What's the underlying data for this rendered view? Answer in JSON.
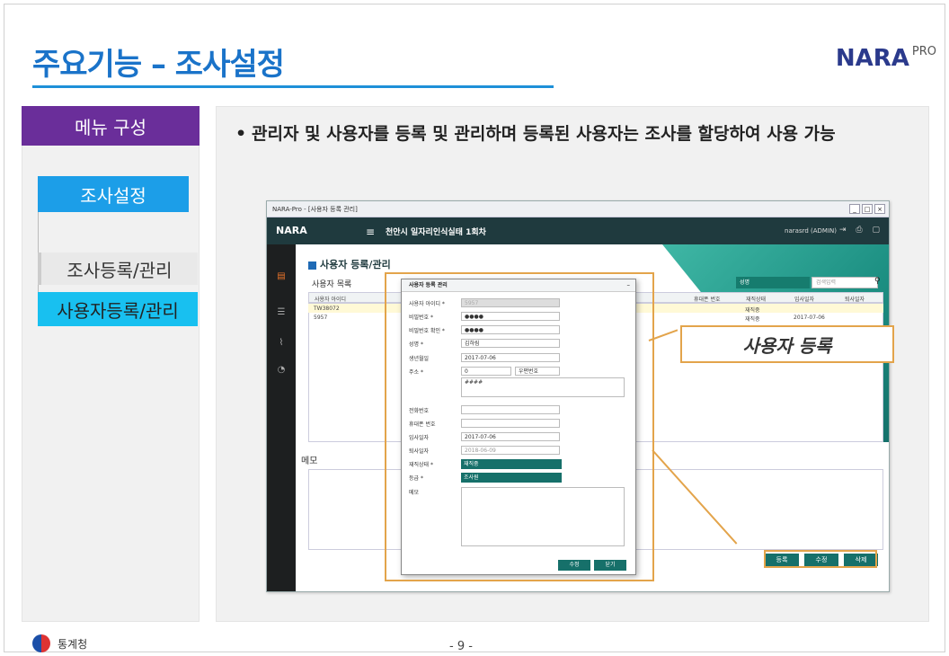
{
  "slide": {
    "title": "주요기능 – 조사설정",
    "logo_text": "NARA",
    "logo_suffix": "PRO",
    "page_number": "- 9 -",
    "footer_org": "통계청"
  },
  "menu": {
    "header": "메뉴 구성",
    "items": [
      {
        "label": "조사설정"
      },
      {
        "label": "조사등록/관리"
      },
      {
        "label": "사용자등록/관리"
      }
    ]
  },
  "description": {
    "bullet": "•",
    "text": "관리자 및 사용자를 등록 및 관리하며 등록된 사용자는 조사를 할당하여 사용 가능"
  },
  "callout": {
    "label": "사용자 등록"
  },
  "app": {
    "window_title": "NARA-Pro - [사용자 등록 관리]",
    "logo": "NARA",
    "survey_name": "천안시 일자리인식실태 1회차",
    "user": "narasrd (ADMIN)",
    "page_title": "사용자 등록/관리",
    "list_label": "사용자 목록",
    "search_select": "성명",
    "search_placeholder": "검색입력",
    "columns": [
      "사용자 아이디",
      "휴대폰 번호",
      "재직상태",
      "입사일자",
      "퇴사일자"
    ],
    "rows": [
      {
        "id": "TW38072",
        "status": "재직중",
        "date": ""
      },
      {
        "id": "5957",
        "status": "재직중",
        "date": "2017-07-06"
      }
    ],
    "memo_label": "메모",
    "buttons": [
      "등록",
      "수정",
      "삭제"
    ]
  },
  "modal": {
    "title": "사용자 등록 관리",
    "fields": [
      {
        "label": "사용자 아이디 *",
        "value": "5957"
      },
      {
        "label": "비밀번호 *",
        "value": "●●●●"
      },
      {
        "label": "비밀번호 확인 *",
        "value": "●●●●"
      },
      {
        "label": "성명 *",
        "value": "김하림"
      },
      {
        "label": "생년월일",
        "value": "2017-07-06"
      },
      {
        "label": "주소 *",
        "value": "0"
      },
      {
        "label": "전화번호",
        "value": ""
      },
      {
        "label": "휴대폰 번호",
        "value": ""
      },
      {
        "label": "입사일자",
        "value": "2017-07-06"
      },
      {
        "label": "퇴사일자",
        "value": "2018-06-09"
      },
      {
        "label": "재직상태 *",
        "value": "재직중"
      },
      {
        "label": "등급 *",
        "value": "조사원"
      },
      {
        "label": "메모",
        "value": ""
      }
    ],
    "zip_button": "우편번호",
    "address_detail": "####",
    "buttons": [
      "수정",
      "닫기"
    ]
  }
}
